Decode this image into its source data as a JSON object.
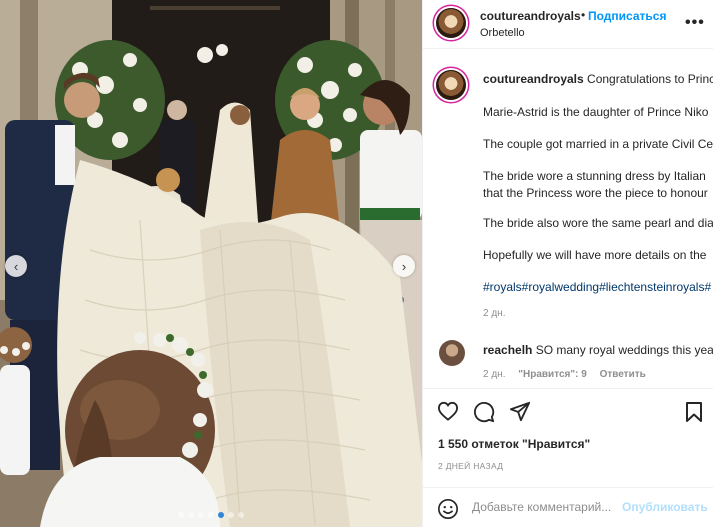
{
  "post": {
    "username": "coutureandroyals",
    "follow_label": "Подписаться",
    "follow_separator": "•",
    "location": "Orbetello",
    "more_label": "•••",
    "colors": {
      "accent": "#0095f6",
      "link": "#00376b",
      "muted": "#8e8e8e"
    }
  },
  "carousel": {
    "dot_count": 7,
    "active_index": 4
  },
  "caption": {
    "username": "coutureandroyals",
    "lines": [
      "Congratulations to Princ",
      "Marie-Astrid is the daughter of Prince Niko",
      "The couple got married in a private Civil Ce",
      "The bride wore a stunning dress by Italian",
      "that the Princess wore the piece to honour",
      "The bride also wore the same pearl and dia",
      "Hopefully we will have more details on the"
    ],
    "hashtags": "#royals#royalwedding#liechtensteinroyals#",
    "time": "2 дн."
  },
  "comment": {
    "username": "reachelh",
    "text": "SO many royal weddings this yea",
    "time": "2 дн.",
    "likes": "\"Нравится\": 9",
    "reply": "Ответить"
  },
  "actions": {
    "icons": [
      "heart-icon",
      "comment-icon",
      "share-icon",
      "bookmark-icon"
    ],
    "likes": "1 550 отметок \"Нравится\"",
    "date": "2 ДНЕЙ НАЗАД"
  },
  "add_comment": {
    "placeholder": "Добавьте комментарий...",
    "publish_label": "Опубликовать",
    "emoji_icon": "smiley-icon"
  }
}
